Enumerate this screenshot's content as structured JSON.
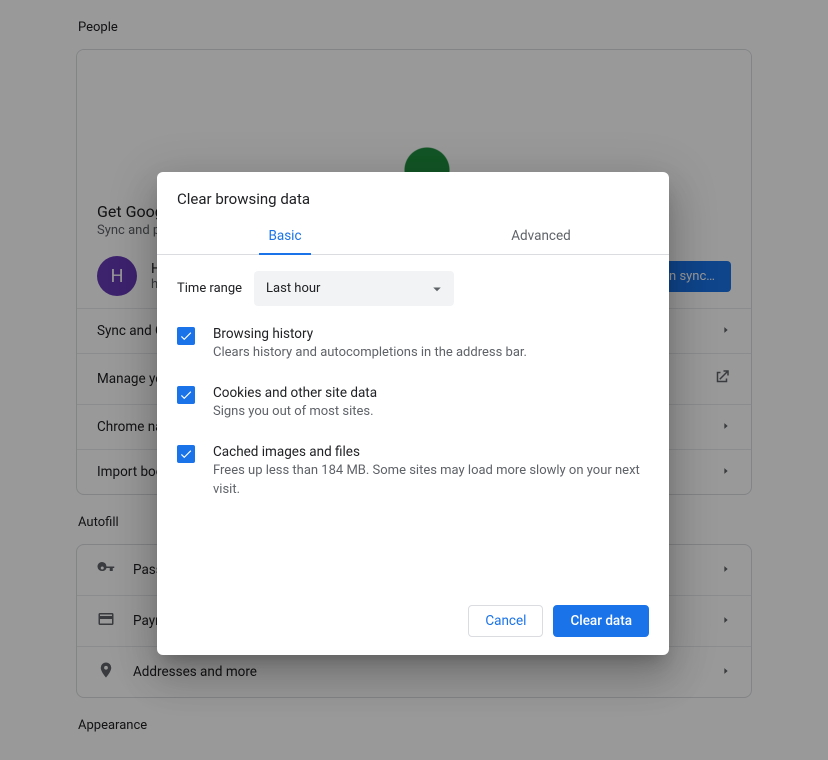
{
  "sections": {
    "people": "People",
    "autofill": "Autofill",
    "appearance": "Appearance"
  },
  "promo": {
    "title": "Get Google smarts in Chrome",
    "subtitle": "Sync and personalize Chrome across your devices"
  },
  "account": {
    "initial": "H",
    "name": "H",
    "email": "h",
    "sync_button": "Turn on sync…"
  },
  "people_rows": {
    "sync": "Sync and Google services",
    "manage": "Manage your Google Account",
    "name": "Chrome name and picture",
    "import": "Import bookmarks and settings"
  },
  "autofill_rows": {
    "passwords": "Passwords",
    "payment": "Payment methods",
    "addresses": "Addresses and more"
  },
  "dialog": {
    "title": "Clear browsing data",
    "tabs": {
      "basic": "Basic",
      "advanced": "Advanced"
    },
    "time_range_label": "Time range",
    "time_range_value": "Last hour",
    "options": [
      {
        "title": "Browsing history",
        "sub": "Clears history and autocompletions in the address bar."
      },
      {
        "title": "Cookies and other site data",
        "sub": "Signs you out of most sites."
      },
      {
        "title": "Cached images and files",
        "sub": "Frees up less than 184 MB. Some sites may load more slowly on your next visit."
      }
    ],
    "cancel": "Cancel",
    "clear": "Clear data"
  }
}
